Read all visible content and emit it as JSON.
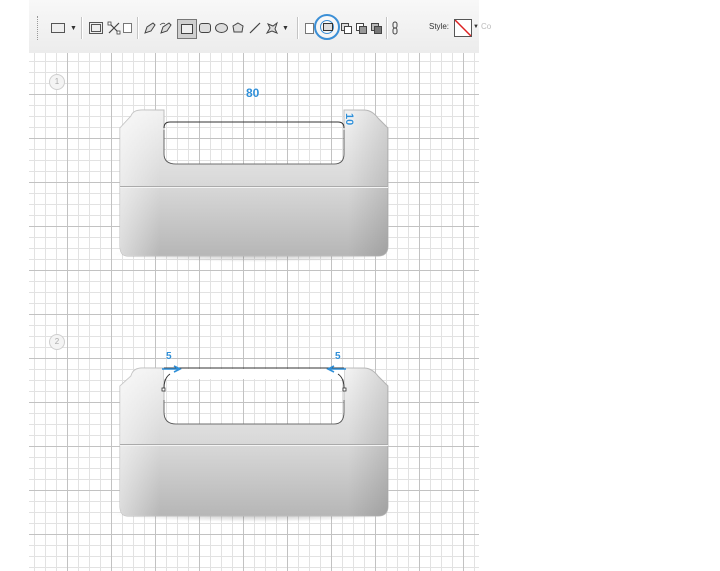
{
  "toolbar": {
    "style_label": "Style:",
    "color_label": "Co"
  },
  "artboard": {
    "step1": {
      "badge": "1",
      "width_dim": "80",
      "height_dim": "10"
    },
    "step2": {
      "badge": "2",
      "left_offset": "5",
      "right_offset": "5"
    }
  },
  "colors": {
    "accent": "#2f8fd8",
    "highlight_ring": "#3b8fd6",
    "shape_fill_top": "#eeeeee",
    "shape_fill_bottom": "#b8b8b8"
  }
}
